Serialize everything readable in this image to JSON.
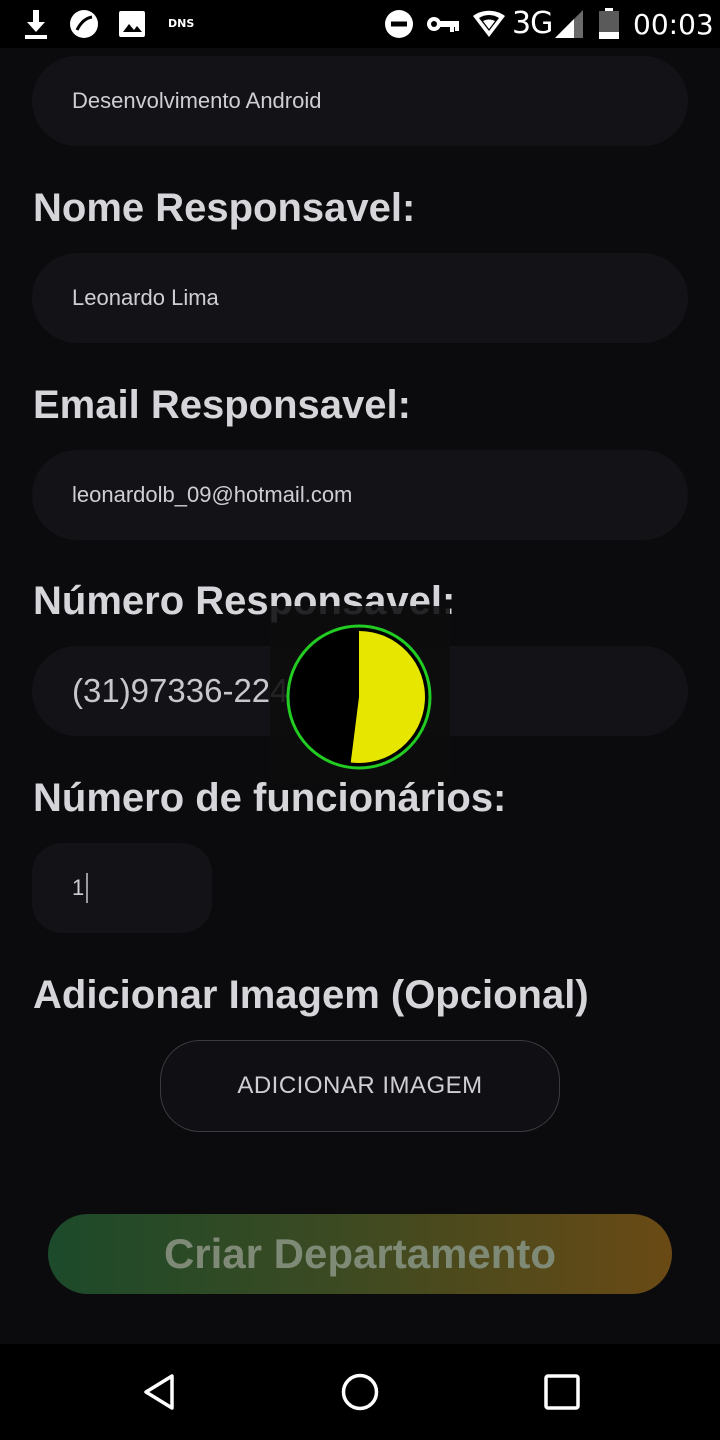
{
  "status_bar": {
    "dns": "DNS",
    "network": "3G",
    "time": "00:03",
    "icons": [
      "download-icon",
      "cricket-icon",
      "image-icon",
      "dns-icon",
      "do-not-disturb-icon",
      "vpn-key-icon",
      "wifi-icon",
      "signal-icon",
      "battery-icon"
    ]
  },
  "form": {
    "department_value": "Desenvolvimento Android",
    "nome_label": "Nome Responsavel:",
    "nome_value": "Leonardo Lima",
    "email_label": "Email  Responsavel:",
    "email_value": "leonardolb_09@hotmail.com",
    "numero_label": "Número  Responsavel:",
    "numero_value": "(31)97336-2242",
    "funcionarios_label": "Número de funcionários:",
    "funcionarios_value": "1",
    "imagem_label": "Adicionar Imagem (Opcional)",
    "add_image_button": "ADICIONAR IMAGEM",
    "create_button": "Criar Departamento"
  },
  "loader": {
    "progress": 0.52,
    "fill_color": "#e6e600",
    "ring_color": "#22cc22"
  },
  "nav_bar": {
    "buttons": [
      "back-icon",
      "home-icon",
      "recents-icon"
    ]
  }
}
